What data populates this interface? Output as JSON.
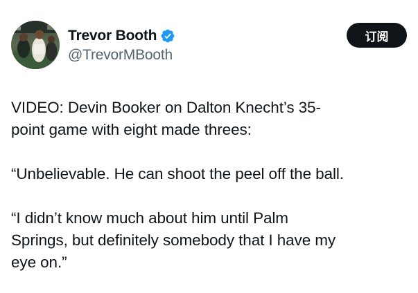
{
  "author": {
    "display_name": "Trevor Booth",
    "handle": "@TrevorMBooth",
    "avatar_icon": "profile-photo",
    "verified_icon": "verified-badge-icon",
    "verified_color": "#1d9bf0"
  },
  "actions": {
    "subscribe_label": "订阅"
  },
  "tweet": {
    "paragraphs": [
      "VIDEO: Devin Booker on Dalton Knecht’s 35-\npoint game with eight made threes:",
      "“Unbelievable. He can shoot the peel off the ball.",
      "“I didn’t know much about him until Palm\nSprings, but definitely somebody that I have my\neye on.”"
    ]
  },
  "colors": {
    "text": "#0f1419",
    "secondary_text": "#536471",
    "button_bg": "#0f1419",
    "button_text": "#ffffff",
    "background": "#ffffff"
  }
}
